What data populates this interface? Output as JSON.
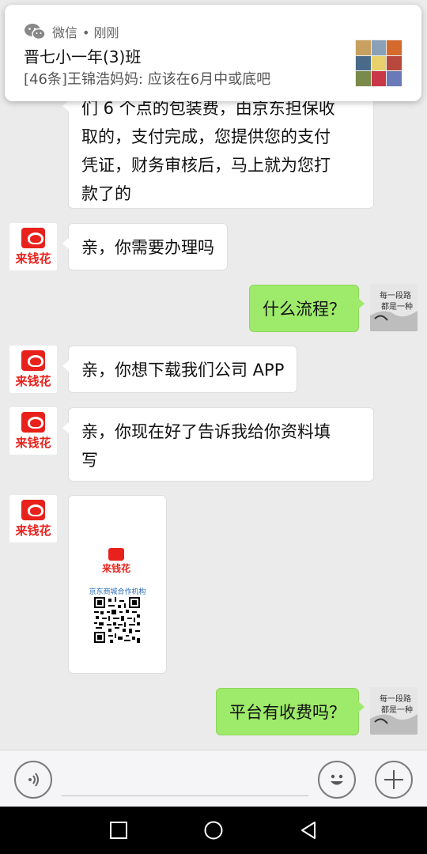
{
  "notification": {
    "app_name": "微信",
    "time": "• 刚刚",
    "title": "晋七小一年(3)班",
    "body": "[46条]王锦浩妈妈: 应该在6月中或底吧",
    "thumb_colors": [
      "#c8a060",
      "#8aa0b8",
      "#d46a2c",
      "#4a6a8a",
      "#e8d06a",
      "#b8483c",
      "#7a8a4a",
      "#c83848",
      "#6a7ab8"
    ]
  },
  "chat": {
    "messages": [
      {
        "id": "m1",
        "side": "in",
        "lines": [
          "们 6 个点的包装费，由京东担保收",
          "取的，支付完成，您提供您的支付",
          "凭证，财务审核后，马上就为您打",
          "款了的"
        ]
      },
      {
        "id": "m2",
        "side": "in",
        "text": "亲，你需要办理吗"
      },
      {
        "id": "m3",
        "side": "out",
        "text": "什么流程？"
      },
      {
        "id": "m4",
        "side": "in",
        "text": "亲，你想下载我们公司 APP"
      },
      {
        "id": "m5",
        "side": "in",
        "lines": [
          "亲，你现在好了告诉我给你资料填",
          "写"
        ]
      },
      {
        "id": "m6",
        "side": "in",
        "type": "image"
      },
      {
        "id": "m7",
        "side": "out",
        "text": "平台有收费吗？"
      }
    ],
    "brand_avatar_text": "来钱花",
    "qr_card": {
      "logo_text": "来钱花",
      "subtitle": "京东商城合作机构"
    },
    "user_avatar_text_1": "每一段路",
    "user_avatar_text_2": "都是一种领悟"
  },
  "input_bar": {
    "voice_icon": "voice-icon",
    "emoji_icon": "emoji-icon",
    "plus_icon": "plus-icon",
    "text_value": ""
  },
  "colors": {
    "outgoing_bubble": "#9eea6a",
    "incoming_bubble": "#ffffff",
    "brand_red": "#e8211c",
    "background": "#ebebeb"
  }
}
